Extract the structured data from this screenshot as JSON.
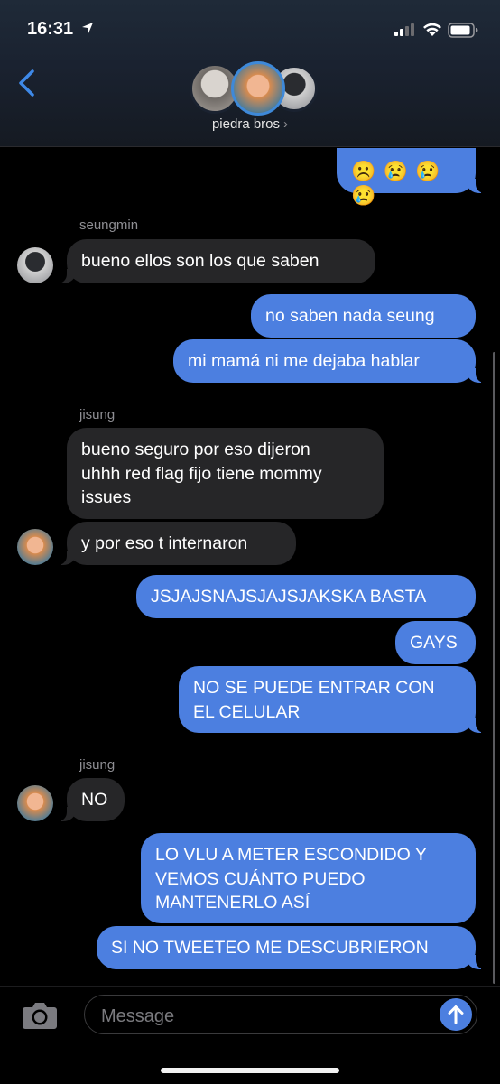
{
  "status_bar": {
    "time": "16:31"
  },
  "header": {
    "group_name": "piedra bros",
    "chevron": "›"
  },
  "messages": {
    "m1": "☹️ 😢 😢 😢",
    "s1": "seungmin",
    "m2": "bueno ellos son los que saben",
    "m3": "no saben nada seung",
    "m4": "mi mamá ni me dejaba hablar",
    "s2": "jisung",
    "m5_l1": "bueno seguro por eso dijeron",
    "m5_l2": "uhhh red flag fijo tiene mommy",
    "m5_l3": "issues",
    "m6": "y por eso t internaron",
    "m7": "JSJAJSNAJSJAJSJAKSKA BASTA",
    "m8": "GAYS",
    "m9_l1": "NO SE PUEDE ENTRAR CON",
    "m9_l2": "EL CELULAR",
    "s3": "jisung",
    "m10": "NO",
    "m11_l1": "LO VLU A METER ESCONDIDO Y",
    "m11_l2": "VEMOS CUÁNTO PUEDO",
    "m11_l3": "MANTENERLO ASÍ",
    "m12": "SI NO TWEETEO ME DESCUBRIERON"
  },
  "input": {
    "placeholder": "Message"
  },
  "colors": {
    "outgoing": "#4c7fe0",
    "incoming": "#262628",
    "background": "#000000"
  }
}
